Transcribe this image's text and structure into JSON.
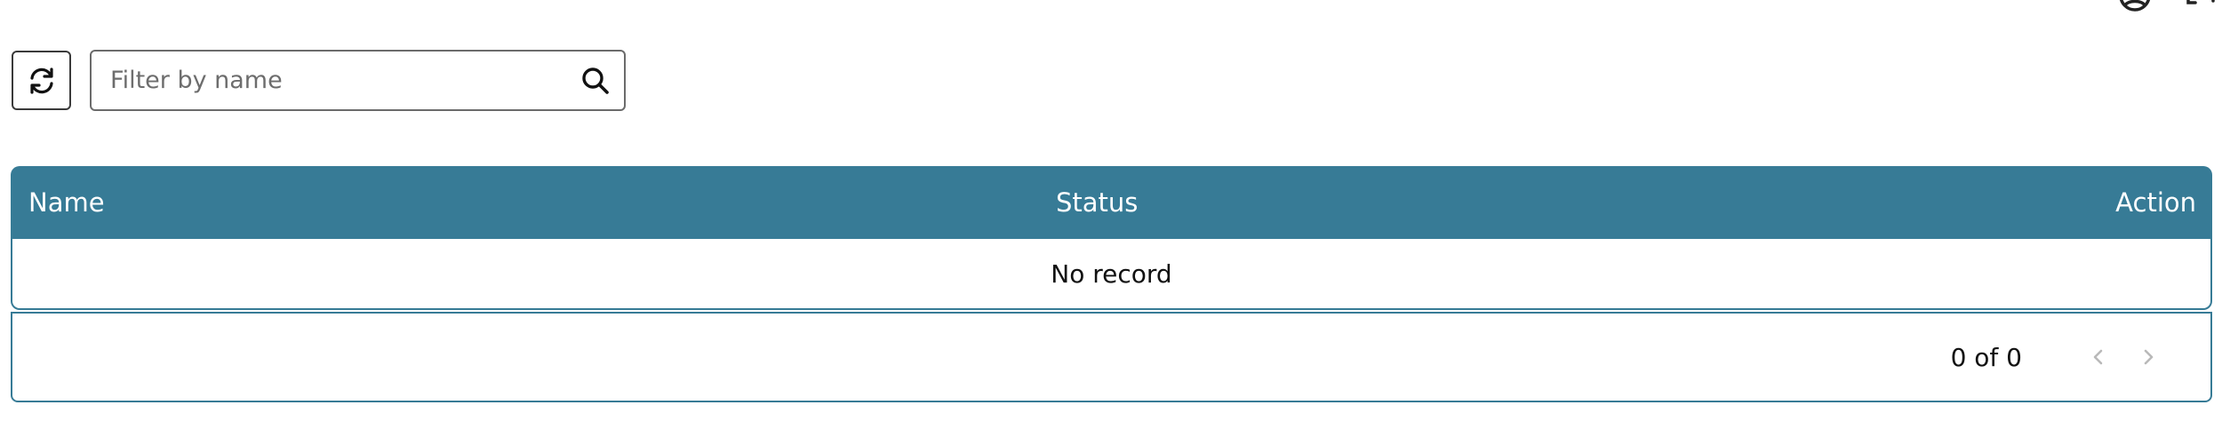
{
  "header": {
    "icons": [
      "user-circle-icon",
      "expand-icon"
    ]
  },
  "toolbar": {
    "refresh_icon": "refresh-icon",
    "search": {
      "placeholder": "Filter by name",
      "value": "",
      "icon": "search-icon"
    }
  },
  "table": {
    "columns": [
      "Name",
      "Status",
      "Action"
    ],
    "rows": [],
    "empty_text": "No record"
  },
  "pagination": {
    "summary": "0 of 0",
    "prev_icon": "chevron-left-icon",
    "next_icon": "chevron-right-icon"
  },
  "colors": {
    "header_bg": "#377b96",
    "header_text": "#ffffff",
    "border": "#377b96",
    "disabled_icon": "#b9b9b9"
  }
}
